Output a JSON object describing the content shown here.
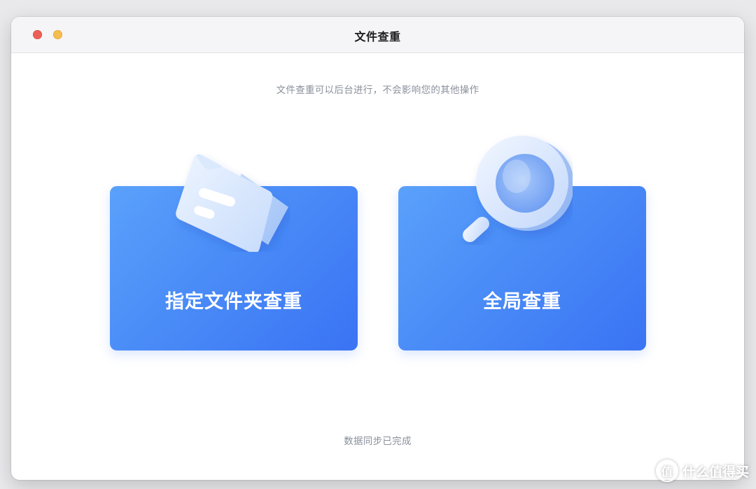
{
  "window": {
    "title": "文件查重"
  },
  "subtitle": "文件查重可以后台进行，不会影响您的其他操作",
  "cards": [
    {
      "label": "指定文件夹查重",
      "icon": "folder-icon"
    },
    {
      "label": "全局查重",
      "icon": "magnifier-icon"
    }
  ],
  "footer": {
    "status": "数据同步已完成"
  },
  "watermark": {
    "badge": "值",
    "text": "什么值得买"
  },
  "colors": {
    "card_gradient_start": "#5aa1fb",
    "card_gradient_end": "#3a73f4",
    "close": "#ec5f57",
    "minimize": "#f4bd4f",
    "secondary_text": "#8a909b"
  }
}
